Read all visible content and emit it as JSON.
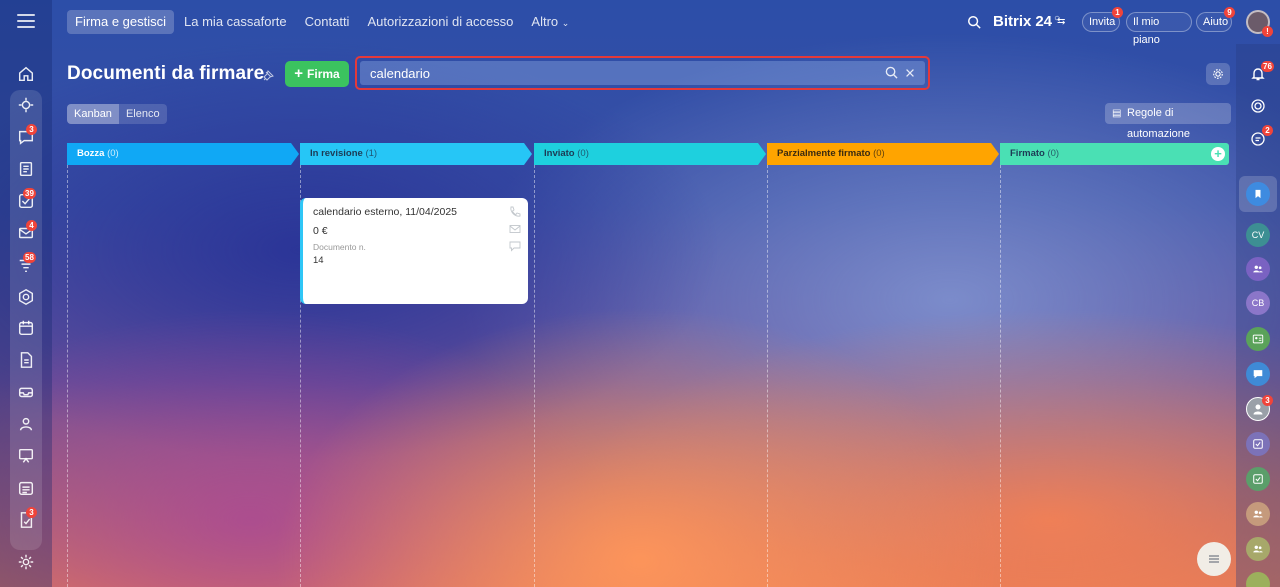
{
  "top_nav": {
    "items": [
      "Firma e gestisci",
      "La mia cassaforte",
      "Contatti",
      "Autorizzazioni di accesso",
      "Altro"
    ],
    "brand": "Bitrix",
    "brand_num": "24",
    "invite": "Invita",
    "invite_badge": "1",
    "plan": "Il mio piano",
    "help": "Aiuto",
    "help_badge": "9",
    "avatar_badge": "!"
  },
  "header": {
    "title": "Documenti da firmare",
    "firma_label": "Firma",
    "search_value": "calendario"
  },
  "view": {
    "kanban": "Kanban",
    "list": "Elenco",
    "automation": "Regole di automazione"
  },
  "columns": [
    {
      "name": "Bozza",
      "count": "(0)",
      "color": "#10a8f5"
    },
    {
      "name": "In revisione",
      "count": "(1)",
      "color": "#26c6f6"
    },
    {
      "name": "Inviato",
      "count": "(0)",
      "color": "#1ed0de"
    },
    {
      "name": "Parzialmente firmato",
      "count": "(0)",
      "color": "#ffa400"
    },
    {
      "name": "Firmato",
      "count": "(0)",
      "color": "#4ae0b4"
    }
  ],
  "card": {
    "title": "calendario esterno, 11/04/2025",
    "amount": "0 €",
    "doc_label": "Documento n.",
    "doc_number": "14"
  },
  "left_badges": {
    "chat": "3",
    "tasks": "39",
    "mail": "4",
    "filters": "58",
    "approvals": "3"
  },
  "right_badges": {
    "notifications": "76",
    "messages": "2",
    "avatar": "3"
  },
  "right_avatars": [
    "CV",
    "CB"
  ]
}
